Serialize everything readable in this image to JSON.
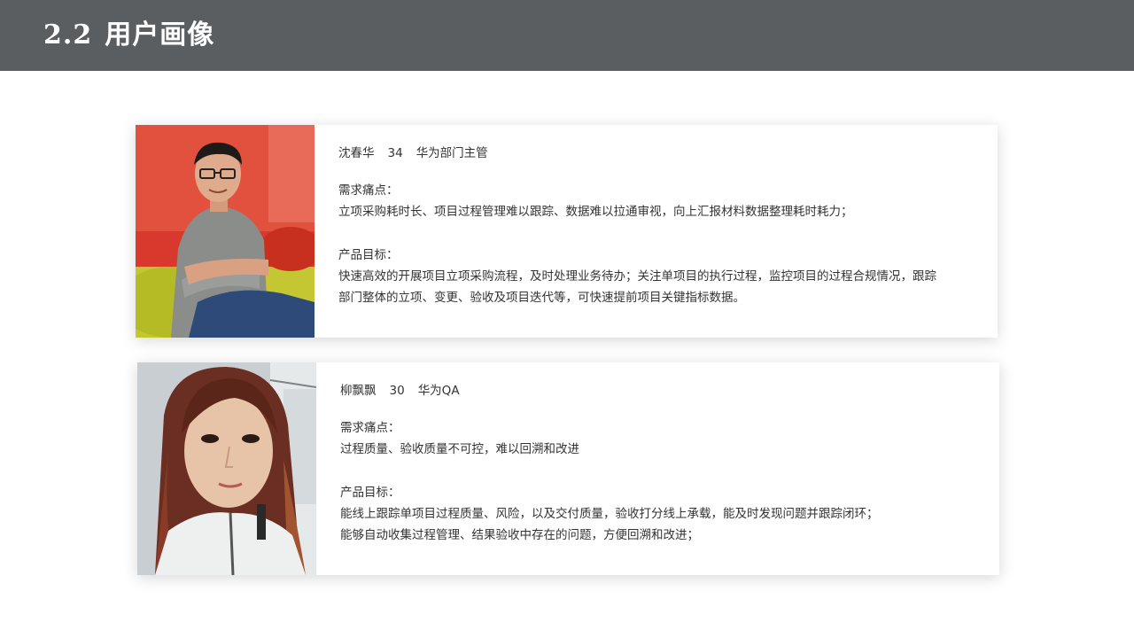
{
  "header": {
    "number": "2.2",
    "title": "用户画像"
  },
  "personas": [
    {
      "name": "沈春华",
      "age": "34",
      "role": "华为部门主管",
      "pain_label": "需求痛点：",
      "pain_text": "立项采购耗时长、项目过程管理难以跟踪、数据难以拉通审视，向上汇报材料数据整理耗时耗力；",
      "goal_label": "产品目标：",
      "goal_lines": [
        "快速高效的开展项目立项采购流程，及时处理业务待办；关注单项目的执行过程，监控项目的过程合规情况，跟踪",
        "部门整体的立项、变更、验收及项目迭代等，可快速提前项目关键指标数据。"
      ]
    },
    {
      "name": "柳飘飘",
      "age": "30",
      "role": "华为QA",
      "pain_label": "需求痛点：",
      "pain_text": "过程质量、验收质量不可控，难以回溯和改进",
      "goal_label": "产品目标：",
      "goal_lines": [
        "能线上跟踪单项目过程质量、风险，以及交付质量，验收打分线上承载，能及时发现问题并跟踪闭环；",
        "能够自动收集过程管理、结果验收中存在的问题，方便回溯和改进；"
      ]
    }
  ],
  "colors": {
    "header_bg": "#5b5e61",
    "text": "#333333"
  }
}
